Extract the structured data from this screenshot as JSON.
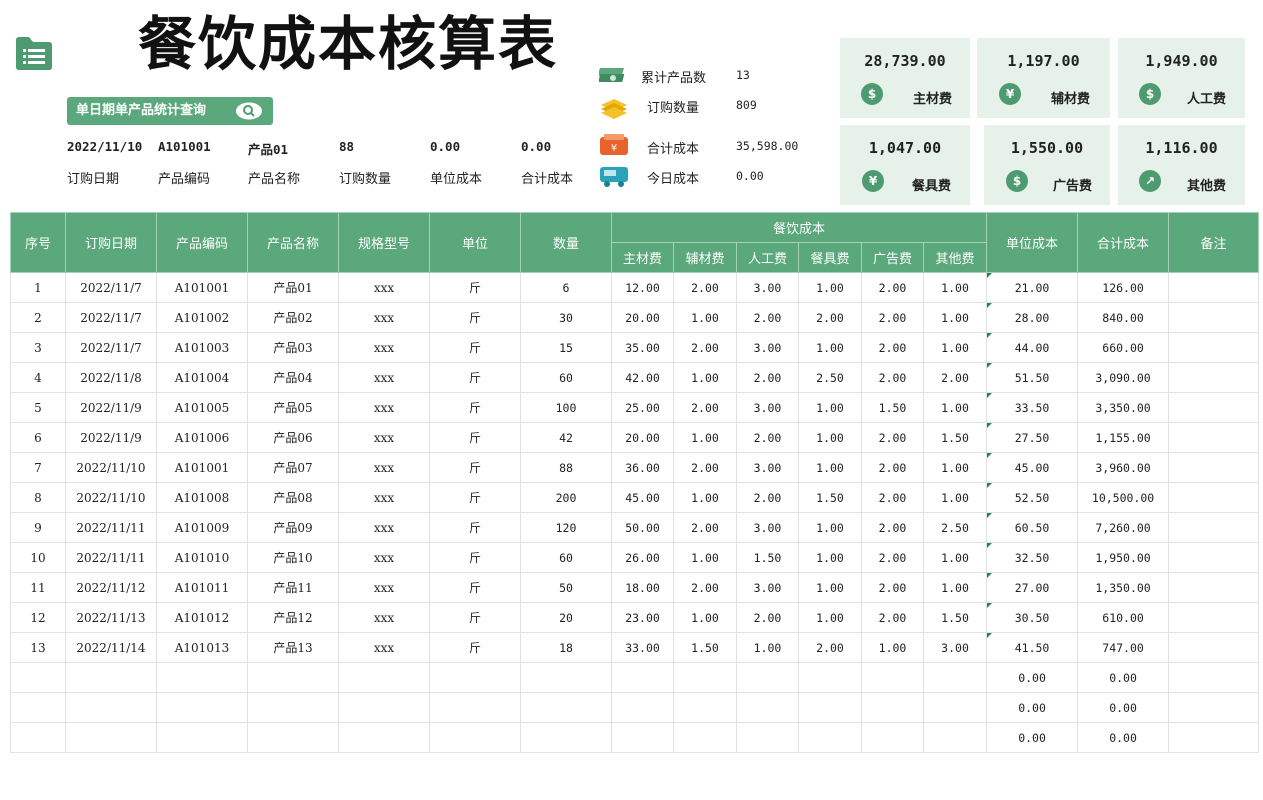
{
  "title": "餐饮成本核算表",
  "query": {
    "button_label": "单日期单产品统计查询",
    "fields": [
      {
        "label": "订购日期",
        "value": "2022/11/10"
      },
      {
        "label": "产品编码",
        "value": "A101001"
      },
      {
        "label": "产品名称",
        "value": "产品01"
      },
      {
        "label": "订购数量",
        "value": "88"
      },
      {
        "label": "单位成本",
        "value": "0.00"
      },
      {
        "label": "合计成本",
        "value": "0.00"
      }
    ]
  },
  "stats": [
    {
      "label": "累计产品数",
      "value": "13",
      "icon": "money-stack-icon"
    },
    {
      "label": "订购数量",
      "value": "809",
      "icon": "coin-stack-icon"
    },
    {
      "label": "合计成本",
      "value": "35,598.00",
      "icon": "cash-register-icon"
    },
    {
      "label": "今日成本",
      "value": "0.00",
      "icon": "delivery-truck-icon"
    }
  ],
  "cards": [
    {
      "value": "28,739.00",
      "label": "主材费",
      "icon": "$",
      "icon_name": "dollar-coin-icon"
    },
    {
      "value": "1,197.00",
      "label": "辅材费",
      "icon": "¥",
      "icon_name": "yen-coin-icon"
    },
    {
      "value": "1,949.00",
      "label": "人工费",
      "icon": "$",
      "icon_name": "money-bag-icon"
    },
    {
      "value": "1,047.00",
      "label": "餐具费",
      "icon": "¥",
      "icon_name": "yen-coin-icon"
    },
    {
      "value": "1,550.00",
      "label": "广告费",
      "icon": "$",
      "icon_name": "dollar-coin-icon"
    },
    {
      "value": "1,116.00",
      "label": "其他费",
      "icon": "↗",
      "icon_name": "chart-icon"
    }
  ],
  "table": {
    "headers": {
      "seq": "序号",
      "date": "订购日期",
      "code": "产品编码",
      "name": "产品名称",
      "spec": "规格型号",
      "unit": "单位",
      "qty": "数量",
      "cost_group": "餐饮成本",
      "unit_cost": "单位成本",
      "total_cost": "合计成本",
      "note": "备注"
    },
    "cost_headers": [
      "主材费",
      "辅材费",
      "人工费",
      "餐具费",
      "广告费",
      "其他费"
    ],
    "rows": [
      [
        "1",
        "2022/11/7",
        "A101001",
        "产品01",
        "xxx",
        "斤",
        "6",
        "12.00",
        "2.00",
        "3.00",
        "1.00",
        "2.00",
        "1.00",
        "21.00",
        "126.00",
        ""
      ],
      [
        "2",
        "2022/11/7",
        "A101002",
        "产品02",
        "xxx",
        "斤",
        "30",
        "20.00",
        "1.00",
        "2.00",
        "2.00",
        "2.00",
        "1.00",
        "28.00",
        "840.00",
        ""
      ],
      [
        "3",
        "2022/11/7",
        "A101003",
        "产品03",
        "xxx",
        "斤",
        "15",
        "35.00",
        "2.00",
        "3.00",
        "1.00",
        "2.00",
        "1.00",
        "44.00",
        "660.00",
        ""
      ],
      [
        "4",
        "2022/11/8",
        "A101004",
        "产品04",
        "xxx",
        "斤",
        "60",
        "42.00",
        "1.00",
        "2.00",
        "2.50",
        "2.00",
        "2.00",
        "51.50",
        "3,090.00",
        ""
      ],
      [
        "5",
        "2022/11/9",
        "A101005",
        "产品05",
        "xxx",
        "斤",
        "100",
        "25.00",
        "2.00",
        "3.00",
        "1.00",
        "1.50",
        "1.00",
        "33.50",
        "3,350.00",
        ""
      ],
      [
        "6",
        "2022/11/9",
        "A101006",
        "产品06",
        "xxx",
        "斤",
        "42",
        "20.00",
        "1.00",
        "2.00",
        "1.00",
        "2.00",
        "1.50",
        "27.50",
        "1,155.00",
        ""
      ],
      [
        "7",
        "2022/11/10",
        "A101001",
        "产品07",
        "xxx",
        "斤",
        "88",
        "36.00",
        "2.00",
        "3.00",
        "1.00",
        "2.00",
        "1.00",
        "45.00",
        "3,960.00",
        ""
      ],
      [
        "8",
        "2022/11/10",
        "A101008",
        "产品08",
        "xxx",
        "斤",
        "200",
        "45.00",
        "1.00",
        "2.00",
        "1.50",
        "2.00",
        "1.00",
        "52.50",
        "10,500.00",
        ""
      ],
      [
        "9",
        "2022/11/11",
        "A101009",
        "产品09",
        "xxx",
        "斤",
        "120",
        "50.00",
        "2.00",
        "3.00",
        "1.00",
        "2.00",
        "2.50",
        "60.50",
        "7,260.00",
        ""
      ],
      [
        "10",
        "2022/11/11",
        "A101010",
        "产品10",
        "xxx",
        "斤",
        "60",
        "26.00",
        "1.00",
        "1.50",
        "1.00",
        "2.00",
        "1.00",
        "32.50",
        "1,950.00",
        ""
      ],
      [
        "11",
        "2022/11/12",
        "A101011",
        "产品11",
        "xxx",
        "斤",
        "50",
        "18.00",
        "2.00",
        "3.00",
        "1.00",
        "2.00",
        "1.00",
        "27.00",
        "1,350.00",
        ""
      ],
      [
        "12",
        "2022/11/13",
        "A101012",
        "产品12",
        "xxx",
        "斤",
        "20",
        "23.00",
        "1.00",
        "2.00",
        "1.00",
        "2.00",
        "1.50",
        "30.50",
        "610.00",
        ""
      ],
      [
        "13",
        "2022/11/14",
        "A101013",
        "产品13",
        "xxx",
        "斤",
        "18",
        "33.00",
        "1.50",
        "1.00",
        "2.00",
        "1.00",
        "3.00",
        "41.50",
        "747.00",
        ""
      ],
      [
        "",
        "",
        "",
        "",
        "",
        "",
        "",
        "",
        "",
        "",
        "",
        "",
        "",
        "0.00",
        "0.00",
        ""
      ],
      [
        "",
        "",
        "",
        "",
        "",
        "",
        "",
        "",
        "",
        "",
        "",
        "",
        "",
        "0.00",
        "0.00",
        ""
      ],
      [
        "",
        "",
        "",
        "",
        "",
        "",
        "",
        "",
        "",
        "",
        "",
        "",
        "",
        "0.00",
        "0.00",
        ""
      ]
    ]
  }
}
